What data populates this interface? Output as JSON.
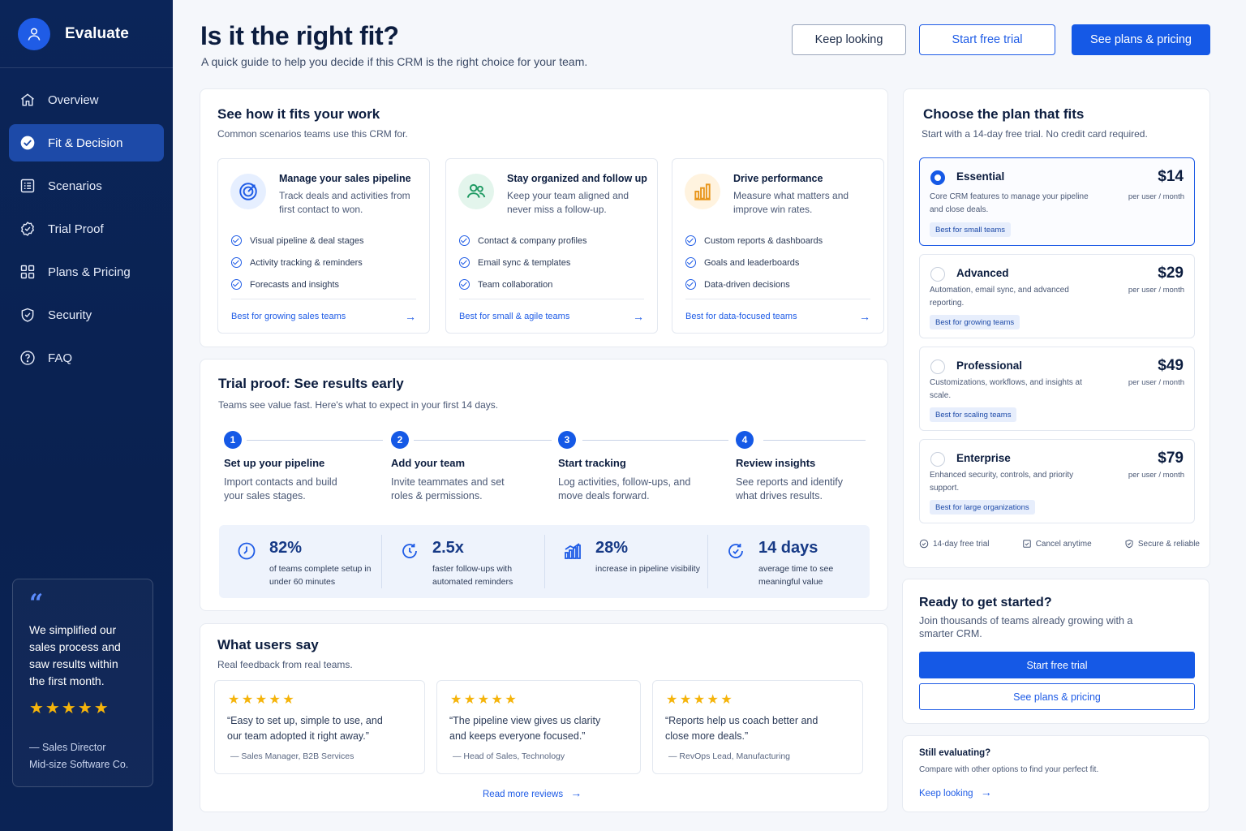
{
  "brand": {
    "title": "Evaluate"
  },
  "nav": [
    {
      "label": "Overview",
      "icon": "home-icon"
    },
    {
      "label": "Fit & Decision",
      "icon": "check-circle-icon",
      "active": true
    },
    {
      "label": "Scenarios",
      "icon": "list-icon"
    },
    {
      "label": "Trial Proof",
      "icon": "badge-check-icon"
    },
    {
      "label": "Plans & Pricing",
      "icon": "grid-icon"
    },
    {
      "label": "Security",
      "icon": "shield-icon"
    },
    {
      "label": "FAQ",
      "icon": "help-icon"
    }
  ],
  "testimonial": {
    "quote": "We simplified our sales process and saw results within the first month.",
    "stars": "★★★★★",
    "author_role": "— Sales Director",
    "author_company": "Mid-size Software Co."
  },
  "header": {
    "title": "Is it the right fit?",
    "subtitle": "A quick guide to help you decide if this CRM is the right choice for your team.",
    "keep_looking": "Keep looking",
    "start_trial": "Start free trial",
    "see_plans": "See plans & pricing"
  },
  "fit": {
    "title": "See how it fits your work",
    "subtitle": "Common scenarios teams use this CRM for.",
    "cards": [
      {
        "title": "Manage your sales pipeline",
        "desc": "Track deals and activities from first contact to won.",
        "items": [
          "Visual pipeline & deal stages",
          "Activity tracking & reminders",
          "Forecasts and insights"
        ],
        "footer": "Best for growing sales teams"
      },
      {
        "title": "Stay organized and follow up",
        "desc": "Keep your team aligned and never miss a follow-up.",
        "items": [
          "Contact & company profiles",
          "Email sync & templates",
          "Team collaboration"
        ],
        "footer": "Best for small & agile teams"
      },
      {
        "title": "Drive performance",
        "desc": "Measure what matters and improve win rates.",
        "items": [
          "Custom reports & dashboards",
          "Goals and leaderboards",
          "Data-driven decisions"
        ],
        "footer": "Best for data-focused teams"
      }
    ]
  },
  "trial": {
    "title": "Trial proof: See results early",
    "subtitle": "Teams see value fast. Here's what to expect in your first 14 days.",
    "steps": [
      {
        "num": "1",
        "title": "Set up your pipeline",
        "desc": "Import contacts and build your sales stages."
      },
      {
        "num": "2",
        "title": "Add your team",
        "desc": "Invite teammates and set roles & permissions."
      },
      {
        "num": "3",
        "title": "Start tracking",
        "desc": "Log activities, follow-ups, and move deals forward."
      },
      {
        "num": "4",
        "title": "Review insights",
        "desc": "See reports and identify what drives results."
      }
    ],
    "stats": [
      {
        "value": "82%",
        "label": "of teams complete setup in under 60 minutes"
      },
      {
        "value": "2.5x",
        "label": "faster follow-ups with automated reminders"
      },
      {
        "value": "28%",
        "label": "increase in pipeline visibility"
      },
      {
        "value": "14 days",
        "label": "average time to see meaningful value"
      }
    ]
  },
  "reviews": {
    "title": "What users say",
    "subtitle": "Real feedback from real teams.",
    "items": [
      {
        "stars": "★★★★★",
        "text": "“Easy to set up, simple to use, and our team adopted it right away.”",
        "author": "— Sales Manager, B2B Services"
      },
      {
        "stars": "★★★★★",
        "text": "“The pipeline view gives us clarity and keeps everyone focused.”",
        "author": "— Head of Sales, Technology"
      },
      {
        "stars": "★★★★★",
        "text": "“Reports help us coach better and close more deals.”",
        "author": "— RevOps Lead, Manufacturing"
      }
    ],
    "read_more": "Read more reviews"
  },
  "plans": {
    "title": "Choose the plan that fits",
    "subtitle": "Start with a 14-day free trial. No credit card required.",
    "items": [
      {
        "name": "Essential",
        "desc": "Core CRM features to manage your pipeline and close deals.",
        "price": "$14",
        "unit": "per user / month",
        "tag": "Best for small teams",
        "selected": true
      },
      {
        "name": "Advanced",
        "desc": "Automation, email sync, and advanced reporting.",
        "price": "$29",
        "unit": "per user / month",
        "tag": "Best for growing teams"
      },
      {
        "name": "Professional",
        "desc": "Customizations, workflows, and insights at scale.",
        "price": "$49",
        "unit": "per user / month",
        "tag": "Best for scaling teams"
      },
      {
        "name": "Enterprise",
        "desc": "Enhanced security, controls, and priority support.",
        "price": "$79",
        "unit": "per user / month",
        "tag": "Best for large organizations"
      }
    ],
    "footer": [
      "14-day free trial",
      "Cancel anytime",
      "Secure & reliable"
    ]
  },
  "ready": {
    "title": "Ready to get started?",
    "subtitle": "Join thousands of teams already growing with a smarter CRM.",
    "primary": "Start free trial",
    "secondary": "See plans & pricing"
  },
  "still": {
    "title": "Still evaluating?",
    "subtitle": "Compare with other options to find your perfect fit.",
    "link": "Keep looking"
  },
  "colors": {
    "accent": "#1559e6",
    "sidebar": "#0b2559",
    "star": "#f5b40b"
  }
}
